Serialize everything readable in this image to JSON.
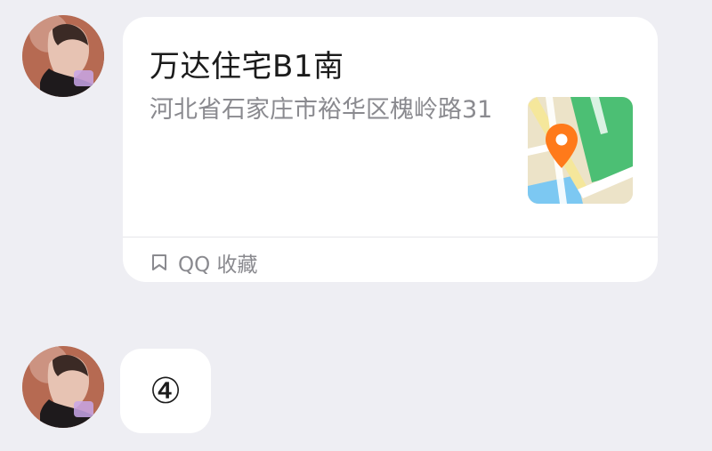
{
  "messages": [
    {
      "type": "location",
      "title": "万达住宅B1南",
      "address": "河北省石家庄市裕华区槐岭路31",
      "source_label": "QQ 收藏"
    },
    {
      "type": "text",
      "text": "④"
    }
  ],
  "colors": {
    "background": "#eeeef3",
    "card": "#ffffff",
    "title_text": "#1b1b1b",
    "secondary_text": "#8a8a8f",
    "map_pin": "#ff7a1a",
    "map_green": "#4cbf74",
    "map_road": "#f5e79b",
    "map_water": "#7cc8f2"
  },
  "icons": {
    "map": "map-thumbnail-icon",
    "pin": "location-pin-icon",
    "source": "bookmark-icon"
  }
}
